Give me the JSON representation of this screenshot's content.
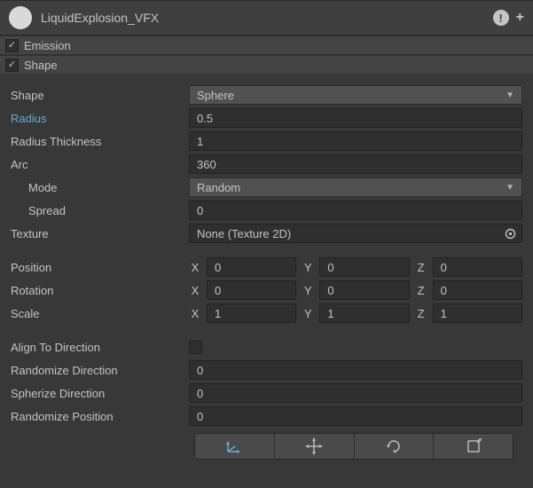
{
  "header": {
    "title": "LiquidExplosion_VFX",
    "alertText": "!"
  },
  "modules": {
    "emission": {
      "label": "Emission",
      "checked": true
    },
    "shape": {
      "label": "Shape",
      "checked": true
    }
  },
  "shape": {
    "labels": {
      "shape": "Shape",
      "radius": "Radius",
      "radiusThickness": "Radius Thickness",
      "arc": "Arc",
      "mode": "Mode",
      "spread": "Spread",
      "texture": "Texture",
      "position": "Position",
      "rotation": "Rotation",
      "scale": "Scale",
      "alignToDirection": "Align To Direction",
      "randomizeDirection": "Randomize Direction",
      "spherizeDirection": "Spherize Direction",
      "randomizePosition": "Randomize Position"
    },
    "values": {
      "shape": "Sphere",
      "radius": "0.5",
      "radiusThickness": "1",
      "arc": "360",
      "mode": "Random",
      "spread": "0",
      "texture": "None (Texture 2D)",
      "position": {
        "x": "0",
        "y": "0",
        "z": "0"
      },
      "rotation": {
        "x": "0",
        "y": "0",
        "z": "0"
      },
      "scale": {
        "x": "1",
        "y": "1",
        "z": "1"
      },
      "alignToDirection": false,
      "randomizeDirection": "0",
      "spherizeDirection": "0",
      "randomizePosition": "0"
    },
    "axisLabels": {
      "x": "X",
      "y": "Y",
      "z": "Z"
    }
  }
}
